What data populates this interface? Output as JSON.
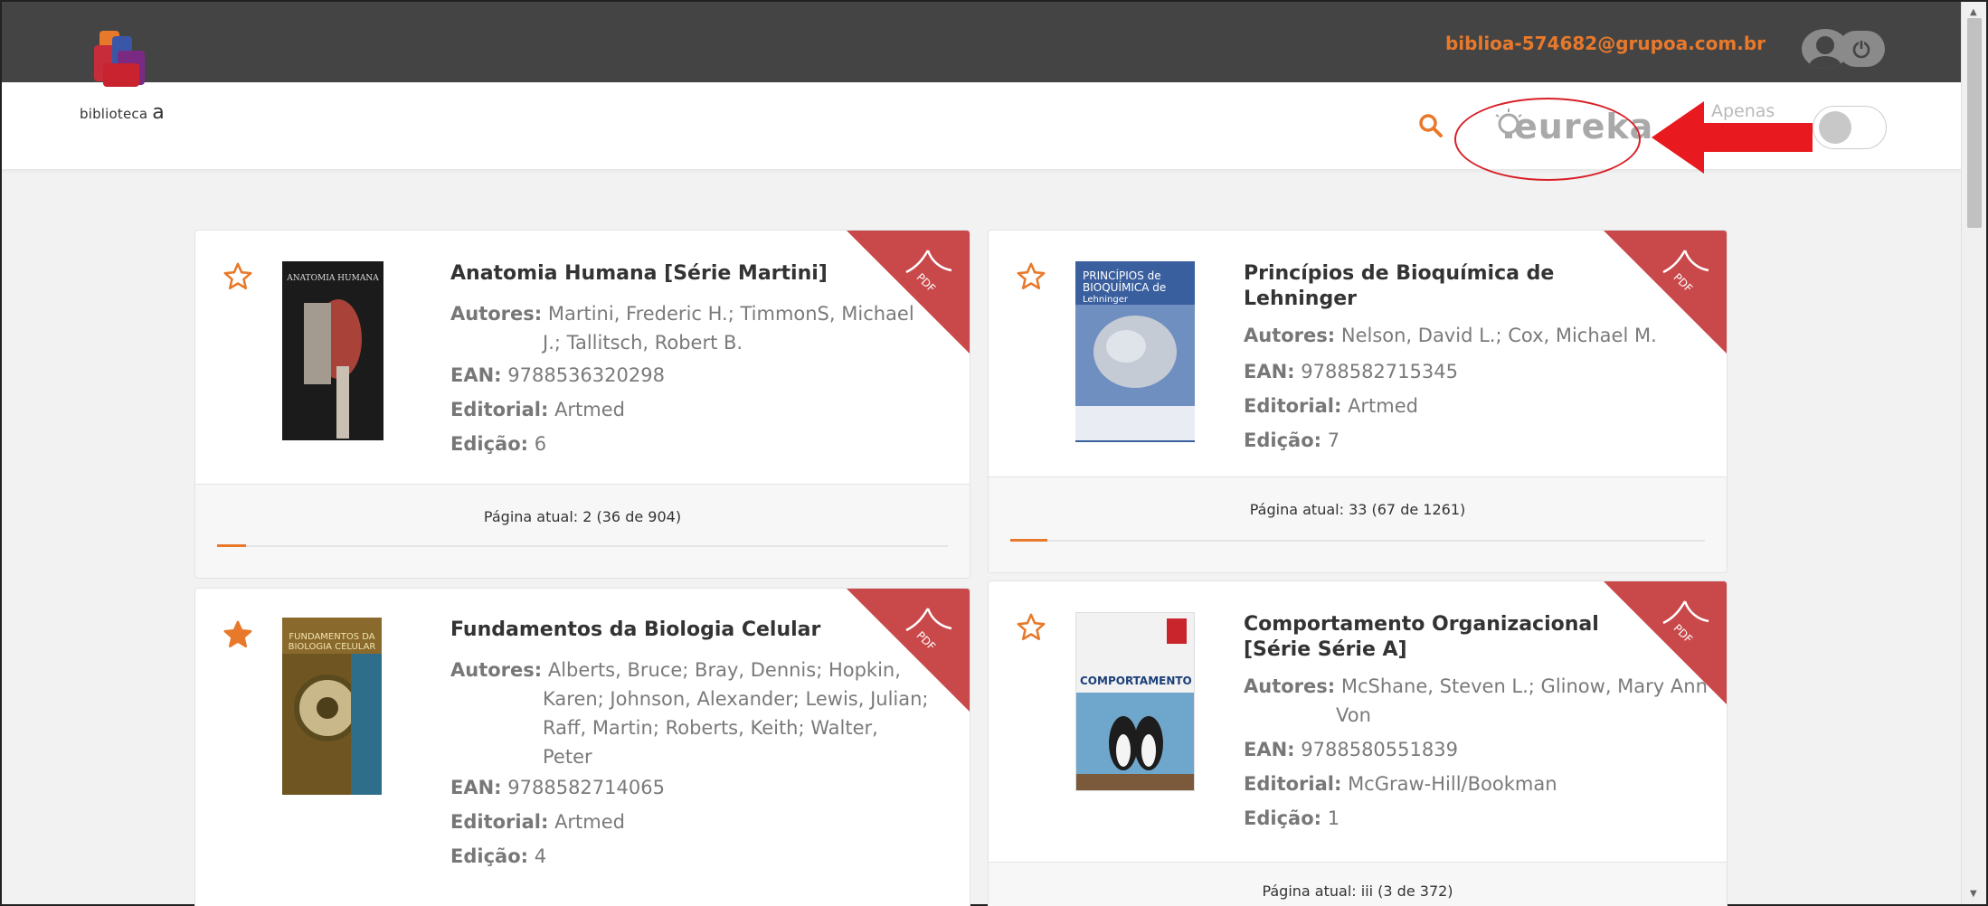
{
  "header": {
    "user_email": "biblioa-574682@grupoa.com.br",
    "logo_text_main": "biblioteca",
    "logo_text_accent": "a",
    "eureka_label": "eureka",
    "filter_label": "Apenas",
    "toggle_on": false
  },
  "labels": {
    "authors": "Autores:",
    "ean": "EAN:",
    "publisher": "Editorial:",
    "edition": "Edição:",
    "pdf_badge": "PDF"
  },
  "colors": {
    "accent": "#e8792b",
    "pdf_badge": "#c9494b",
    "annotation_red": "#d81f26",
    "topbar": "#444444"
  },
  "books": [
    {
      "title": "Anatomia Humana [Série Martini]",
      "authors_line1": "Martini, Frederic H.; TimmonS, Michael",
      "authors_cont": [
        "J.; Tallitsch, Robert B."
      ],
      "ean": "9788536320298",
      "publisher": "Artmed",
      "edition": "6",
      "favorite": false,
      "current_page": "Página atual: 2 (36 de 904)",
      "progress": 0.04,
      "cover_text": "ANATOMIA HUMANA"
    },
    {
      "title_line1": "Princípios de Bioquímica de",
      "title_line2": "Lehninger",
      "authors_line1": "Nelson, David L.; Cox, Michael M.",
      "authors_cont": [],
      "ean": "9788582715345",
      "publisher": "Artmed",
      "edition": "7",
      "favorite": false,
      "current_page": "Página atual: 33 (67 de 1261)",
      "progress": 0.053,
      "cover_text_line1": "PRINCÍPIOS de",
      "cover_text_line2": "BIOQUÍMICA de",
      "cover_text_line3": "Lehninger"
    },
    {
      "title": "Fundamentos da Biologia Celular",
      "authors_line1": "Alberts, Bruce; Bray, Dennis; Hopkin,",
      "authors_cont": [
        "Karen; Johnson, Alexander; Lewis, Julian;",
        "Raff, Martin; Roberts, Keith; Walter,",
        "Peter"
      ],
      "ean": "9788582714065",
      "publisher": "Artmed",
      "edition": "4",
      "favorite": true,
      "cover_text_line1": "FUNDAMENTOS DA",
      "cover_text_line2": "BIOLOGIA CELULAR"
    },
    {
      "title_line1": "Comportamento Organizacional",
      "title_line2": "[Série Série A]",
      "authors_line1": "McShane, Steven L.; Glinow, Mary Ann",
      "authors_cont": [
        "Von"
      ],
      "ean": "9788580551839",
      "publisher": "McGraw-Hill/Bookman",
      "edition": "1",
      "favorite": false,
      "current_page": "Página atual: iii (3 de 372)",
      "cover_text": "COMPORTAMENTO"
    }
  ]
}
